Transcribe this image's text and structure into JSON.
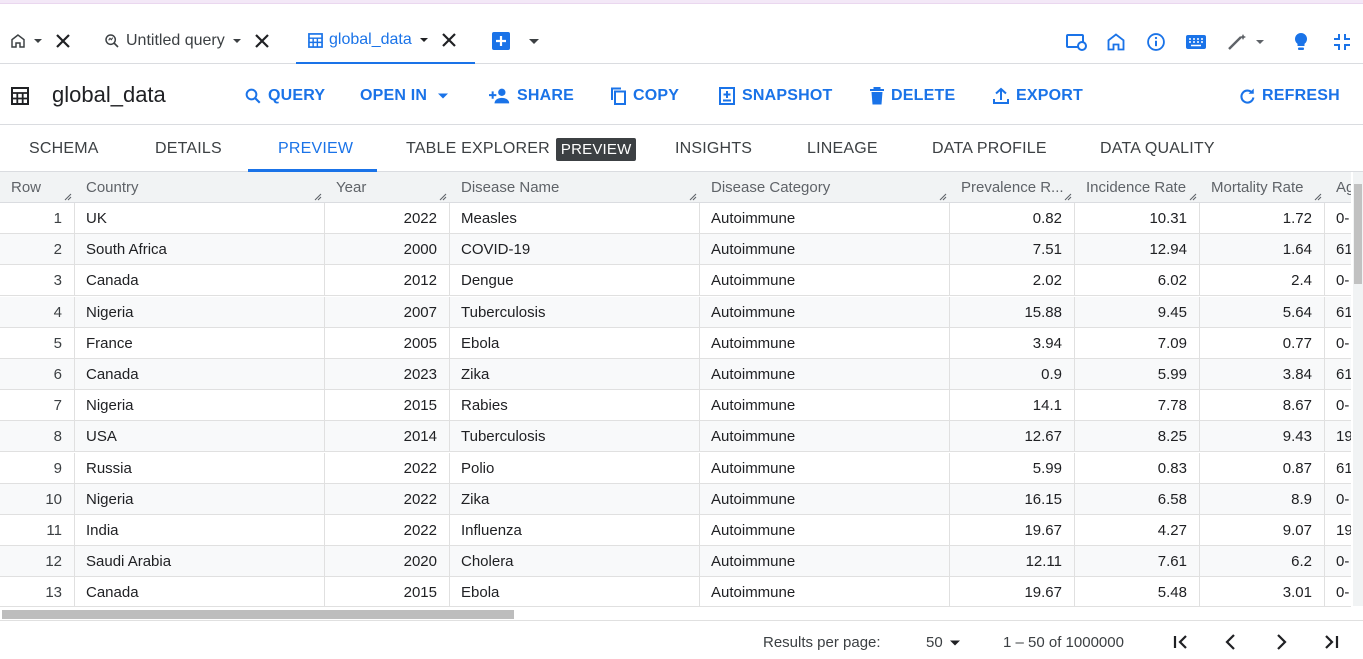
{
  "tabs": {
    "query_label": "Untitled query",
    "global_label": "global_data"
  },
  "toolbar": {
    "title": "global_data",
    "query": "QUERY",
    "open_in": "OPEN IN",
    "share": "SHARE",
    "copy": "COPY",
    "snapshot": "SNAPSHOT",
    "delete": "DELETE",
    "export": "EXPORT",
    "refresh": "REFRESH"
  },
  "subtabs": {
    "schema": "SCHEMA",
    "details": "DETAILS",
    "preview": "PREVIEW",
    "table_explorer": "TABLE EXPLORER",
    "table_explorer_badge": "PREVIEW",
    "insights": "INSIGHTS",
    "lineage": "LINEAGE",
    "data_profile": "DATA PROFILE",
    "data_quality": "DATA QUALITY"
  },
  "columns": [
    "Row",
    "Country",
    "Year",
    "Disease Name",
    "Disease Category",
    "Prevalence R...",
    "Incidence Rate",
    "Mortality Rate",
    "Ag"
  ],
  "rows": [
    [
      "1",
      "UK",
      "2022",
      "Measles",
      "Autoimmune",
      "0.82",
      "10.31",
      "1.72",
      "0-"
    ],
    [
      "2",
      "South Africa",
      "2000",
      "COVID-19",
      "Autoimmune",
      "7.51",
      "12.94",
      "1.64",
      "61"
    ],
    [
      "3",
      "Canada",
      "2012",
      "Dengue",
      "Autoimmune",
      "2.02",
      "6.02",
      "2.4",
      "0-"
    ],
    [
      "4",
      "Nigeria",
      "2007",
      "Tuberculosis",
      "Autoimmune",
      "15.88",
      "9.45",
      "5.64",
      "61"
    ],
    [
      "5",
      "France",
      "2005",
      "Ebola",
      "Autoimmune",
      "3.94",
      "7.09",
      "0.77",
      "0-"
    ],
    [
      "6",
      "Canada",
      "2023",
      "Zika",
      "Autoimmune",
      "0.9",
      "5.99",
      "3.84",
      "61"
    ],
    [
      "7",
      "Nigeria",
      "2015",
      "Rabies",
      "Autoimmune",
      "14.1",
      "7.78",
      "8.67",
      "0-"
    ],
    [
      "8",
      "USA",
      "2014",
      "Tuberculosis",
      "Autoimmune",
      "12.67",
      "8.25",
      "9.43",
      "19"
    ],
    [
      "9",
      "Russia",
      "2022",
      "Polio",
      "Autoimmune",
      "5.99",
      "0.83",
      "0.87",
      "61"
    ],
    [
      "10",
      "Nigeria",
      "2022",
      "Zika",
      "Autoimmune",
      "16.15",
      "6.58",
      "8.9",
      "0-"
    ],
    [
      "11",
      "India",
      "2022",
      "Influenza",
      "Autoimmune",
      "19.67",
      "4.27",
      "9.07",
      "19"
    ],
    [
      "12",
      "Saudi Arabia",
      "2020",
      "Cholera",
      "Autoimmune",
      "12.11",
      "7.61",
      "6.2",
      "0-"
    ],
    [
      "13",
      "Canada",
      "2015",
      "Ebola",
      "Autoimmune",
      "19.67",
      "5.48",
      "3.01",
      "0-"
    ]
  ],
  "footer": {
    "results_label": "Results per page:",
    "page_size": "50",
    "range": "1 – 50 of 1000000"
  },
  "colors": {
    "accent": "#1a73e8",
    "text": "#202124",
    "muted": "#5f6368"
  }
}
